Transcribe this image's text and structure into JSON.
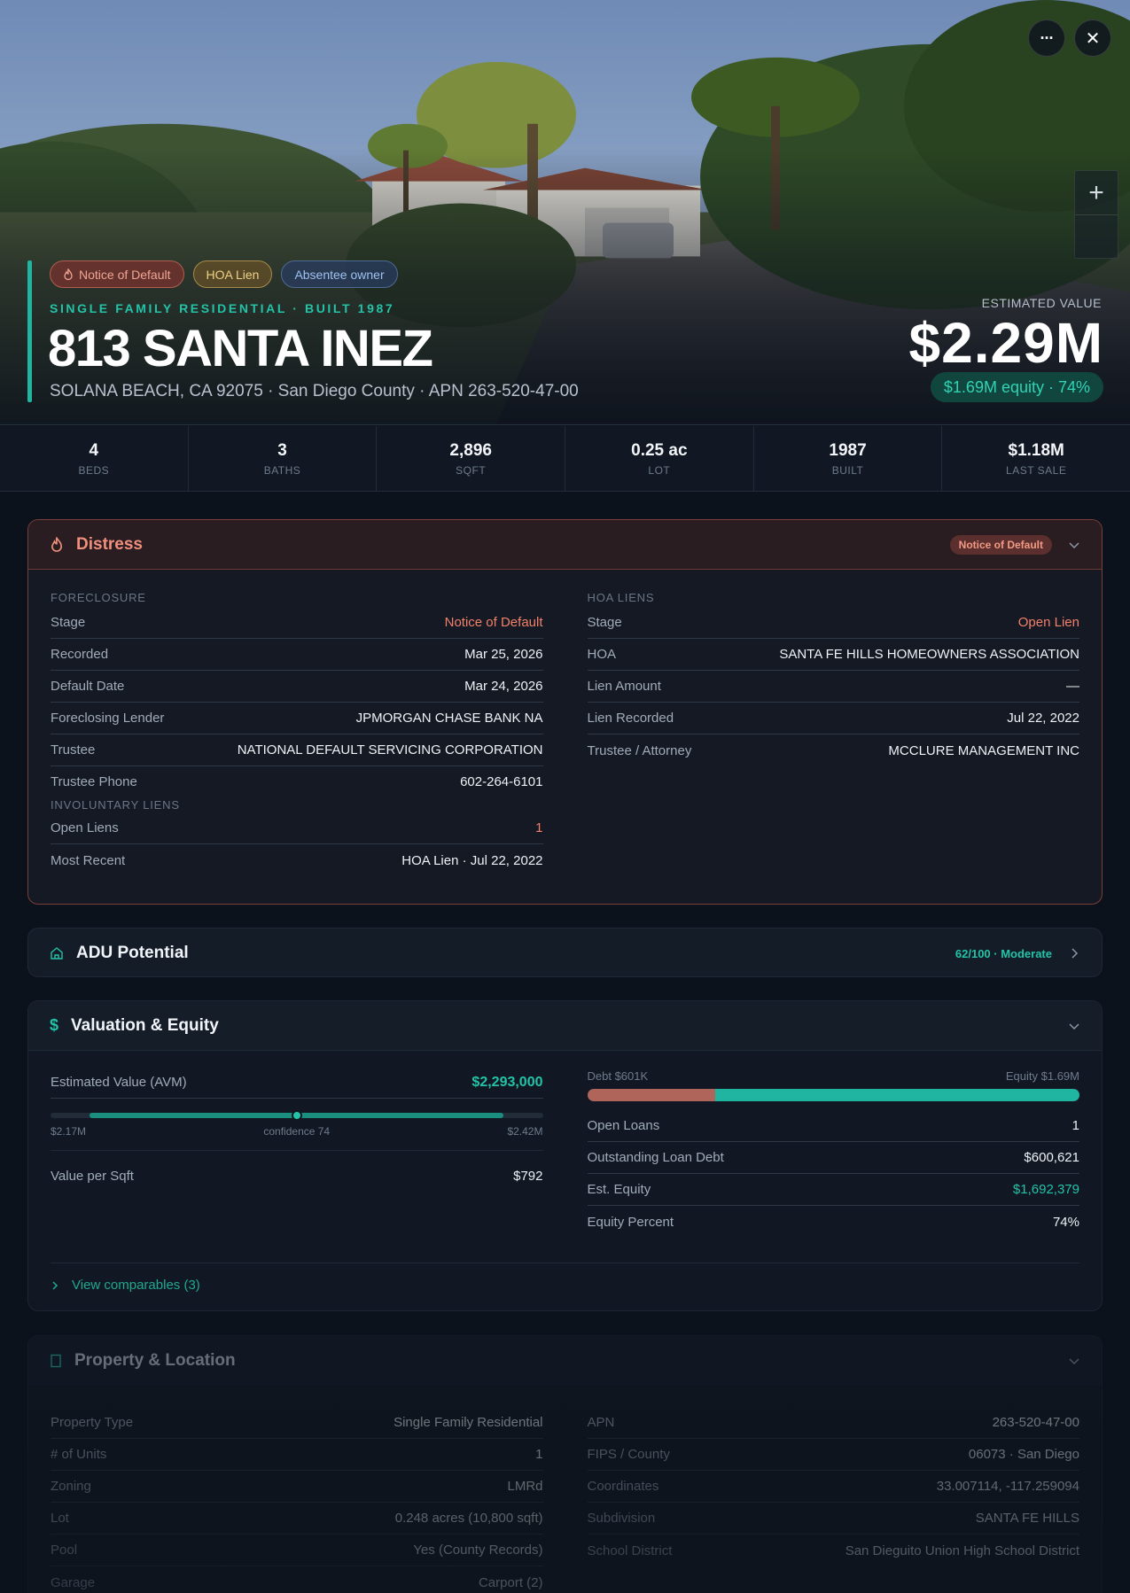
{
  "hero": {
    "badges": [
      {
        "label": "Notice of Default",
        "icon": "flame-icon"
      },
      {
        "label": "HOA Lien"
      },
      {
        "label": "Absentee owner"
      }
    ],
    "property_type_line": "SINGLE FAMILY RESIDENTIAL · BUILT 1987",
    "address": "813 SANTA INEZ",
    "subaddress": "SOLANA BEACH, CA 92075 · San Diego County · APN 263-520-47-00",
    "estimated_label": "ESTIMATED VALUE",
    "estimated_value": "$2.29M",
    "equity_pill": "$1.69M equity · 74%",
    "buttons": {
      "more": "···",
      "close": "✕",
      "zoom_in": "+"
    }
  },
  "stats": [
    {
      "value": "4",
      "label": "BEDS"
    },
    {
      "value": "3",
      "label": "BATHS"
    },
    {
      "value": "2,896",
      "label": "SQFT"
    },
    {
      "value": "0.25 ac",
      "label": "LOT"
    },
    {
      "value": "1987",
      "label": "BUILT"
    },
    {
      "value": "$1.18M",
      "label": "LAST SALE"
    }
  ],
  "distress": {
    "title": "Distress",
    "badge": "Notice of Default",
    "foreclosure_label": "FORECLOSURE",
    "foreclosure": [
      {
        "k": "Stage",
        "v": "Notice of Default"
      },
      {
        "k": "Recorded",
        "v": "Mar 25, 2026"
      },
      {
        "k": "Default Date",
        "v": "Mar 24, 2026"
      },
      {
        "k": "Foreclosing Lender",
        "v": "JPMORGAN CHASE BANK NA"
      },
      {
        "k": "Trustee",
        "v": "NATIONAL DEFAULT SERVICING CORPORATION"
      },
      {
        "k": "Trustee Phone",
        "v": "602-264-6101"
      }
    ],
    "involuntary_label": "INVOLUNTARY LIENS",
    "involuntary": [
      {
        "k": "Open Liens",
        "v": "1"
      },
      {
        "k": "Most Recent",
        "v": "HOA Lien · Jul 22, 2022"
      }
    ],
    "hoa_label": "HOA LIENS",
    "hoa": [
      {
        "k": "Stage",
        "v": "Open Lien"
      },
      {
        "k": "HOA",
        "v": "SANTA FE HILLS HOMEOWNERS ASSOCIATION"
      },
      {
        "k": "Lien Amount",
        "v": "—"
      },
      {
        "k": "Lien Recorded",
        "v": "Jul 22, 2022"
      },
      {
        "k": "Trustee / Attorney",
        "v": "MCCLURE MANAGEMENT INC"
      }
    ]
  },
  "adu": {
    "title": "ADU Potential",
    "score": "62/100 · Moderate"
  },
  "valuation": {
    "title": "Valuation & Equity",
    "avm_label": "Estimated Value (AVM)",
    "avm_value": "$2,293,000",
    "range_low": "$2.17M",
    "range_high": "$2.42M",
    "confidence": "confidence 74",
    "confidence_value": 74,
    "value_per_sqft_label": "Value per Sqft",
    "value_per_sqft": "$792",
    "debt_label": "Debt $601K",
    "equity_label": "Equity $1.69M",
    "debt_fraction": 0.26,
    "loans": [
      {
        "k": "Open Loans",
        "v": "1"
      },
      {
        "k": "Outstanding Loan Debt",
        "v": "$600,621"
      },
      {
        "k": "Est. Equity",
        "v": "$1,692,379"
      },
      {
        "k": "Equity Percent",
        "v": "74%"
      }
    ],
    "comparables": "View comparables (3)"
  },
  "property": {
    "title": "Property & Location",
    "left": [
      {
        "k": "Property Type",
        "v": "Single Family Residential"
      },
      {
        "k": "# of Units",
        "v": "1"
      },
      {
        "k": "Zoning",
        "v": "LMRd"
      },
      {
        "k": "Lot",
        "v": "0.248 acres (10,800 sqft)"
      },
      {
        "k": "Pool",
        "v": "Yes (County Records)"
      },
      {
        "k": "Garage",
        "v": "Carport (2)"
      }
    ],
    "right": [
      {
        "k": "APN",
        "v": "263-520-47-00"
      },
      {
        "k": "FIPS / County",
        "v": "06073 · San Diego"
      },
      {
        "k": "Coordinates",
        "v": "33.007114, -117.259094"
      },
      {
        "k": "Subdivision",
        "v": "SANTA FE HILLS"
      },
      {
        "k": "School District",
        "v": "San Dieguito Union High School District"
      }
    ]
  },
  "colors": {
    "accent": "#23c3a8",
    "distress": "#f08f7b",
    "debt": "#b0655b"
  }
}
